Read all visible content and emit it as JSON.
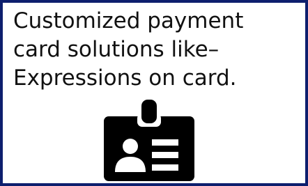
{
  "caption": {
    "lines": [
      "Customized payment",
      "card solutions like–",
      "Expressions on card."
    ]
  },
  "icon": {
    "name": "id-badge-icon",
    "color": "#000000"
  },
  "colors": {
    "border": "#0d1f6e",
    "background": "#ffffff",
    "text": "#111111"
  }
}
